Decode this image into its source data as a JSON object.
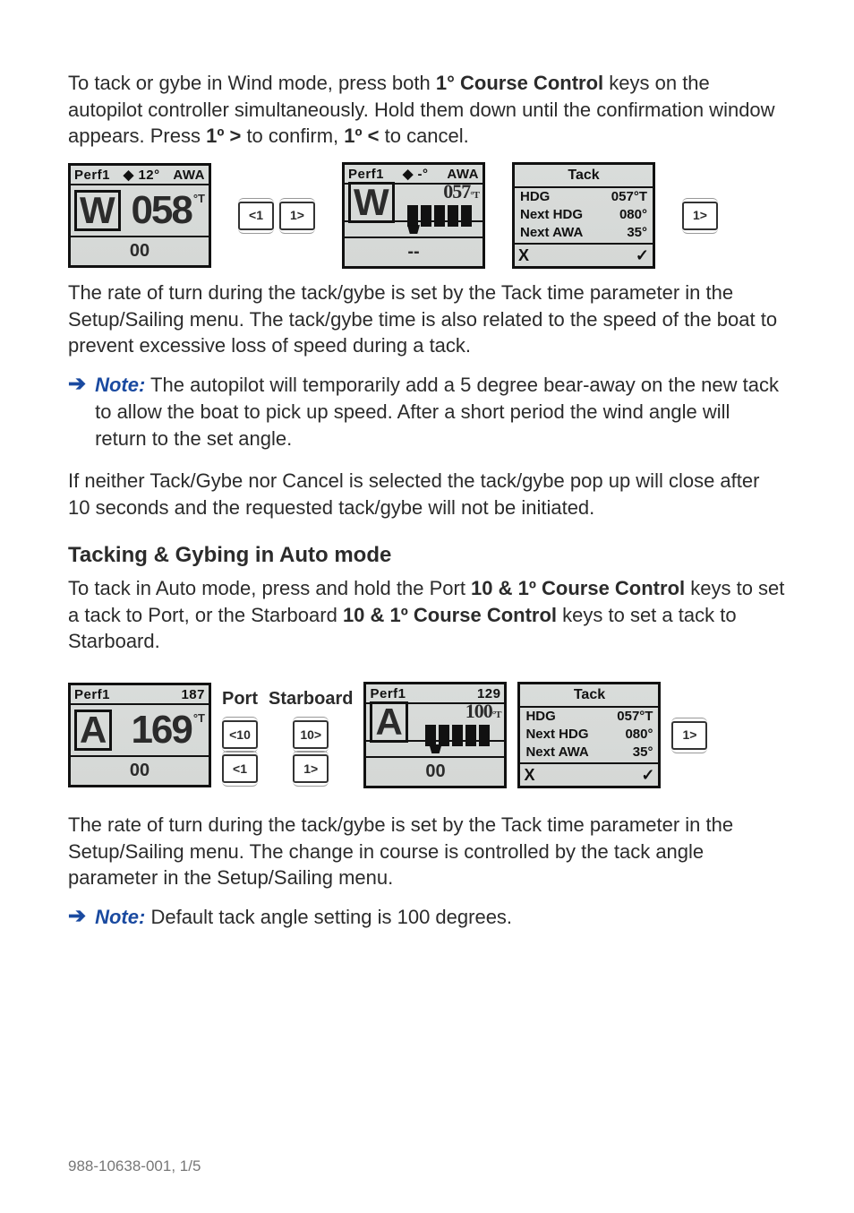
{
  "intro": {
    "p1_a": "To tack or gybe in Wind mode, press both ",
    "p1_bold1": "1° Course Control",
    "p1_b": " keys on the autopilot controller simultaneously. Hold them down until the confirmation window appears. Press ",
    "p1_bold2": "1º >",
    "p1_c": " to confirm, ",
    "p1_bold3": "1º <",
    "p1_d": " to cancel."
  },
  "fig1": {
    "lcd_left": {
      "tl1": "Perf1",
      "tl2": "12°",
      "tl3": "AWA",
      "mode": "W",
      "big": "058",
      "unit": "°T",
      "sub": "00"
    },
    "keys": {
      "l": "<1",
      "r": "1>"
    },
    "lcd_mid": {
      "tl1": "Perf1",
      "tl2": "-°",
      "tl3": "AWA",
      "mode": "W",
      "big": "057",
      "unit": "°T",
      "sub": "--"
    },
    "tack": {
      "title": "Tack",
      "r1l": "HDG",
      "r1r": "057°T",
      "r2l": "Next HDG",
      "r2r": "080°",
      "r3l": "Next AWA",
      "r3r": "35°",
      "x": "X",
      "ok": "✓"
    },
    "confirm_key": "1>"
  },
  "para2": "The rate of turn during the tack/gybe is set by the Tack time parameter in the Setup/Sailing menu. The tack/gybe time is also related to the speed of the boat to prevent excessive loss of speed during a tack.",
  "note1": {
    "label": "Note:",
    "text": " The autopilot will temporarily add a 5 degree bear-away on the new tack to allow the boat to pick up speed. After a short period the wind angle will return to the set angle."
  },
  "para3": "If neither Tack/Gybe nor Cancel is selected the tack/gybe pop up will close after 10 seconds and the requested tack/gybe will not be initiated.",
  "heading2": "Tacking & Gybing in Auto mode",
  "para4": {
    "a": "To tack in Auto mode, press and hold the Port ",
    "b1": "10 & 1º Course Control",
    "b": " keys to set a tack to Port, or the Starboard ",
    "b2": "10 & 1º Course Control",
    "c": " keys to set a tack to Starboard."
  },
  "fig2": {
    "lcd_left": {
      "tl1": "Perf1",
      "tl2": "187",
      "mode": "A",
      "big": "169",
      "unit": "°T",
      "sub": "00"
    },
    "port_label": "Port",
    "star_label": "Starboard",
    "port_keys": {
      "top": "<10",
      "bot": "<1"
    },
    "star_keys": {
      "top": "10>",
      "bot": "1>"
    },
    "lcd_mid": {
      "tl1": "Perf1",
      "tl2": "129",
      "mode": "A",
      "big": "100",
      "unit": "°T",
      "sub": "00"
    },
    "tack": {
      "title": "Tack",
      "r1l": "HDG",
      "r1r": "057°T",
      "r2l": "Next HDG",
      "r2r": "080°",
      "r3l": "Next AWA",
      "r3r": "35°",
      "x": "X",
      "ok": "✓"
    },
    "confirm_key": "1>"
  },
  "para5": "The rate of turn during the tack/gybe is set by the Tack time parameter in the Setup/Sailing menu. The change in course is controlled by the tack angle parameter in the Setup/Sailing menu.",
  "note2": {
    "label": "Note:",
    "text": " Default tack angle setting is 100 degrees."
  },
  "footer": "988-10638-001, 1/5"
}
